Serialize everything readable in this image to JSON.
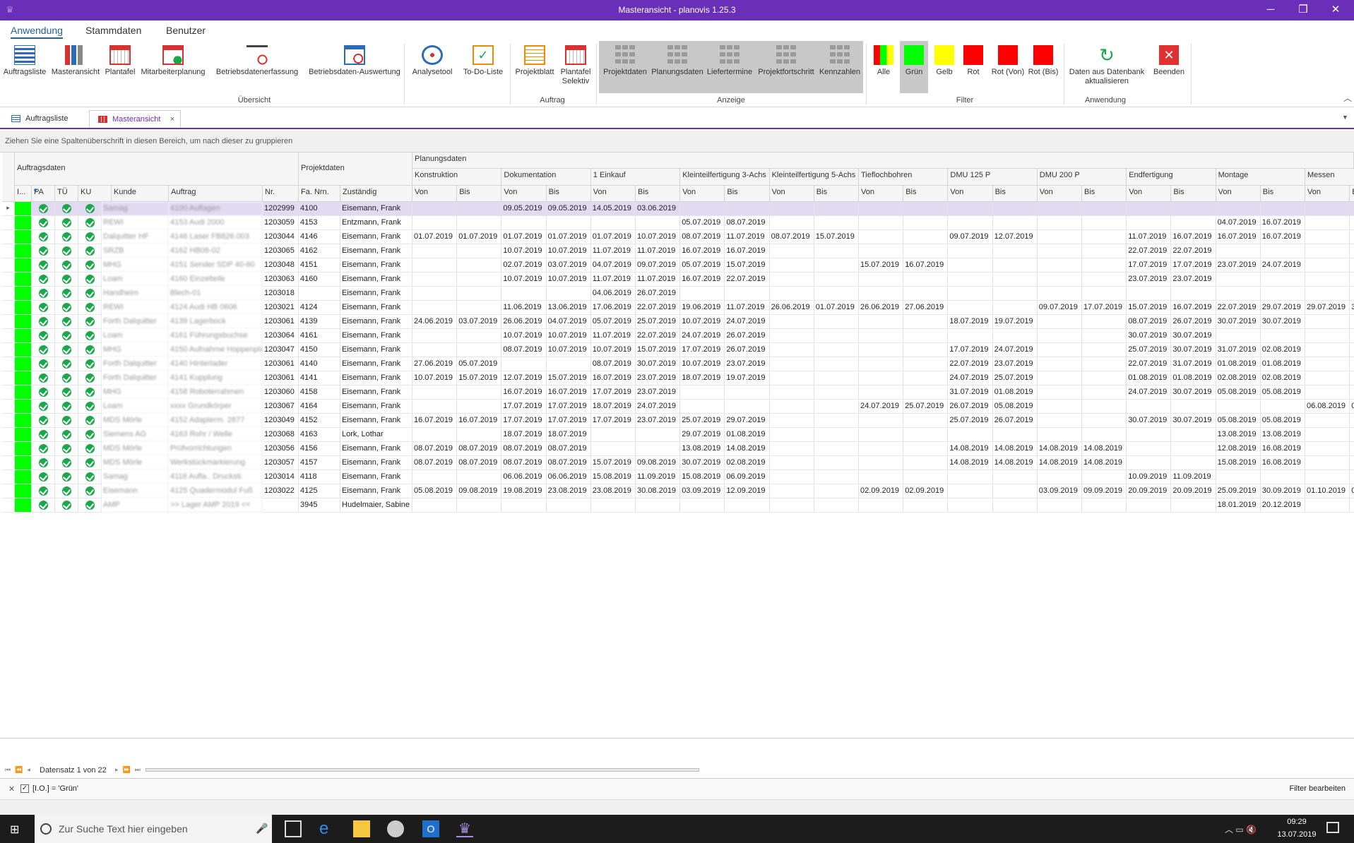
{
  "window": {
    "title": "Masteransicht - planovis 1.25.3"
  },
  "menu": [
    "Anwendung",
    "Stammdaten",
    "Benutzer"
  ],
  "ribbon": {
    "buttons": [
      "Auftragsliste",
      "Masteransicht",
      "Plantafel",
      "Mitarbeiterplanung",
      "Betriebsdatenerfassung",
      "Betriebsdaten-Auswertung",
      "Analysetool",
      "To-Do-Liste",
      "Projektblatt",
      "Plantafel Selektiv",
      "Projektdaten",
      "Planungsdaten",
      "Liefertermine",
      "Projektfortschritt",
      "Kennzahlen",
      "Alle",
      "Grün",
      "Gelb",
      "Rot",
      "Rot (Von)",
      "Rot (Bis)",
      "Daten aus Datenbank aktualisieren",
      "Beenden"
    ],
    "plantafel_selektiv": [
      "Plantafel",
      "Selektiv"
    ],
    "daten_aktualisieren": [
      "Daten aus Datenbank",
      "aktualisieren"
    ],
    "groups": [
      "Übersicht",
      "Auftrag",
      "Anzeige",
      "Filter",
      "Anwendung"
    ],
    "filter_colors": {
      "green": "#00ff00",
      "yellow": "#ffff00",
      "red": "#ff0000"
    }
  },
  "tabs": [
    "Auftragsliste",
    "Masteransicht"
  ],
  "groupbar": "Ziehen Sie eine Spaltenüberschrift in diesen Bereich, um nach dieser zu gruppieren",
  "bands": {
    "auftragsdaten": "Auftragsdaten",
    "projektdaten": "Projektdaten",
    "planungsdaten": "Planungsdaten"
  },
  "phases": [
    "Konstruktion",
    "Dokumentation",
    "1 Einkauf",
    "Kleinteilfertigung 3-Achs",
    "Kleinteilfertigung 5-Achs",
    "Tieflochbohren",
    "DMU 125 P",
    "DMU 200 P",
    "Endfertigung",
    "Montage",
    "Messen"
  ],
  "fixed_columns": [
    "I...",
    "PA",
    "TÜ",
    "KU",
    "Kunde",
    "Auftrag",
    "Nr.",
    "Fa. Nrn.",
    "Zuständig"
  ],
  "von": "Von",
  "bis": "Bis",
  "b_last": "B",
  "rows": [
    {
      "kunde": "Samag",
      "auftrag": "4100 Auflagen",
      "nr": "1202999",
      "fa": "4100",
      "zust": "Eisemann, Frank",
      "d": [
        "",
        "",
        "09.05.2019",
        "09.05.2019",
        "14.05.2019",
        "03.06.2019",
        "",
        "",
        "",
        "",
        "",
        "",
        "",
        "",
        "",
        "",
        "",
        "",
        "",
        "",
        "",
        ""
      ]
    },
    {
      "kunde": "REWI",
      "auftrag": "4153 Audi 2000",
      "nr": "1203059",
      "fa": "4153",
      "zust": "Entzmann, Frank",
      "d": [
        "",
        "",
        "",
        "",
        "",
        "",
        "05.07.2019",
        "08.07.2019",
        "",
        "",
        "",
        "",
        "",
        "",
        "",
        "",
        "",
        "",
        "04.07.2019",
        "16.07.2019",
        "",
        ""
      ]
    },
    {
      "kunde": "Dalquitter HF",
      "auftrag": "4146 Laser FB826.003",
      "nr": "1203044",
      "fa": "4146",
      "zust": "Eisemann, Frank",
      "d": [
        "01.07.2019",
        "01.07.2019",
        "01.07.2019",
        "01.07.2019",
        "01.07.2019",
        "10.07.2019",
        "08.07.2019",
        "11.07.2019",
        "08.07.2019",
        "15.07.2019",
        "",
        "",
        "09.07.2019",
        "12.07.2019",
        "",
        "",
        "11.07.2019",
        "16.07.2019",
        "16.07.2019",
        "16.07.2019",
        "",
        ""
      ]
    },
    {
      "kunde": "SRZB",
      "auftrag": "4162 HB08-02",
      "nr": "1203065",
      "fa": "4162",
      "zust": "Eisemann, Frank",
      "d": [
        "",
        "",
        "10.07.2019",
        "10.07.2019",
        "11.07.2019",
        "11.07.2019",
        "16.07.2019",
        "16.07.2019",
        "",
        "",
        "",
        "",
        "",
        "",
        "",
        "",
        "22.07.2019",
        "22.07.2019",
        "",
        "",
        "",
        ""
      ]
    },
    {
      "kunde": "MHG",
      "auftrag": "4151 Sender SDP 40-60",
      "nr": "1203048",
      "fa": "4151",
      "zust": "Eisemann, Frank",
      "d": [
        "",
        "",
        "02.07.2019",
        "03.07.2019",
        "04.07.2019",
        "09.07.2019",
        "05.07.2019",
        "15.07.2019",
        "",
        "",
        "15.07.2019",
        "16.07.2019",
        "",
        "",
        "",
        "",
        "17.07.2019",
        "17.07.2019",
        "23.07.2019",
        "24.07.2019",
        "",
        ""
      ]
    },
    {
      "kunde": "Loam",
      "auftrag": "4160 Einzelteile",
      "nr": "1203063",
      "fa": "4160",
      "zust": "Eisemann, Frank",
      "d": [
        "",
        "",
        "10.07.2019",
        "10.07.2019",
        "11.07.2019",
        "11.07.2019",
        "16.07.2019",
        "22.07.2019",
        "",
        "",
        "",
        "",
        "",
        "",
        "",
        "",
        "23.07.2019",
        "23.07.2019",
        "",
        "",
        "",
        ""
      ]
    },
    {
      "kunde": "Handheim",
      "auftrag": "Blech-01",
      "nr": "1203018",
      "fa": "",
      "zust": "Eisemann, Frank",
      "d": [
        "",
        "",
        "",
        "",
        "04.06.2019",
        "26.07.2019",
        "",
        "",
        "",
        "",
        "",
        "",
        "",
        "",
        "",
        "",
        "",
        "",
        "",
        "",
        "",
        ""
      ]
    },
    {
      "kunde": "REWI",
      "auftrag": "4124 Audi HB 0606",
      "nr": "1203021",
      "fa": "4124",
      "zust": "Eisemann, Frank",
      "d": [
        "",
        "",
        "11.06.2019",
        "13.06.2019",
        "17.06.2019",
        "22.07.2019",
        "19.06.2019",
        "11.07.2019",
        "26.06.2019",
        "01.07.2019",
        "26.06.2019",
        "27.06.2019",
        "",
        "",
        "09.07.2019",
        "17.07.2019",
        "15.07.2019",
        "16.07.2019",
        "22.07.2019",
        "29.07.2019",
        "29.07.2019",
        "3"
      ]
    },
    {
      "kunde": "Forth Dalquitter",
      "auftrag": "4139 Lagerbock",
      "nr": "1203061",
      "fa": "4139",
      "zust": "Eisemann, Frank",
      "d": [
        "24.06.2019",
        "03.07.2019",
        "26.06.2019",
        "04.07.2019",
        "05.07.2019",
        "25.07.2019",
        "10.07.2019",
        "24.07.2019",
        "",
        "",
        "",
        "",
        "18.07.2019",
        "19.07.2019",
        "",
        "",
        "08.07.2019",
        "26.07.2019",
        "30.07.2019",
        "30.07.2019",
        "",
        ""
      ]
    },
    {
      "kunde": "Loam",
      "auftrag": "4161 Führungsbuchse",
      "nr": "1203064",
      "fa": "4161",
      "zust": "Eisemann, Frank",
      "d": [
        "",
        "",
        "10.07.2019",
        "10.07.2019",
        "11.07.2019",
        "22.07.2019",
        "24.07.2019",
        "26.07.2019",
        "",
        "",
        "",
        "",
        "",
        "",
        "",
        "",
        "30.07.2019",
        "30.07.2019",
        "",
        "",
        "",
        ""
      ]
    },
    {
      "kunde": "MHG",
      "auftrag": "4150 Aufnahme Hoppenplatte",
      "nr": "1203047",
      "fa": "4150",
      "zust": "Eisemann, Frank",
      "d": [
        "",
        "",
        "08.07.2019",
        "10.07.2019",
        "10.07.2019",
        "15.07.2019",
        "17.07.2019",
        "26.07.2019",
        "",
        "",
        "",
        "",
        "17.07.2019",
        "24.07.2019",
        "",
        "",
        "25.07.2019",
        "30.07.2019",
        "31.07.2019",
        "02.08.2019",
        "",
        ""
      ]
    },
    {
      "kunde": "Forth Dalquitter",
      "auftrag": "4140 Hinterlader",
      "nr": "1203061",
      "fa": "4140",
      "zust": "Eisemann, Frank",
      "d": [
        "27.06.2019",
        "05.07.2019",
        "",
        "",
        "08.07.2019",
        "30.07.2019",
        "10.07.2019",
        "23.07.2019",
        "",
        "",
        "",
        "",
        "22.07.2019",
        "23.07.2019",
        "",
        "",
        "22.07.2019",
        "31.07.2019",
        "01.08.2019",
        "01.08.2019",
        "",
        ""
      ]
    },
    {
      "kunde": "Forth Dalquitter",
      "auftrag": "4141 Kupplung",
      "nr": "1203061",
      "fa": "4141",
      "zust": "Eisemann, Frank",
      "d": [
        "10.07.2019",
        "15.07.2019",
        "12.07.2019",
        "15.07.2019",
        "16.07.2019",
        "23.07.2019",
        "18.07.2019",
        "19.07.2019",
        "",
        "",
        "",
        "",
        "24.07.2019",
        "25.07.2019",
        "",
        "",
        "01.08.2019",
        "01.08.2019",
        "02.08.2019",
        "02.08.2019",
        "",
        ""
      ]
    },
    {
      "kunde": "MHG",
      "auftrag": "4158 Roboterrahmen",
      "nr": "1203060",
      "fa": "4158",
      "zust": "Eisemann, Frank",
      "d": [
        "",
        "",
        "16.07.2019",
        "16.07.2019",
        "17.07.2019",
        "23.07.2019",
        "",
        "",
        "",
        "",
        "",
        "",
        "31.07.2019",
        "01.08.2019",
        "",
        "",
        "24.07.2019",
        "30.07.2019",
        "05.08.2019",
        "05.08.2019",
        "",
        ""
      ]
    },
    {
      "kunde": "Loam",
      "auftrag": "xxxx Grundkörper",
      "nr": "1203067",
      "fa": "4164",
      "zust": "Eisemann, Frank",
      "d": [
        "",
        "",
        "17.07.2019",
        "17.07.2019",
        "18.07.2019",
        "24.07.2019",
        "",
        "",
        "",
        "",
        "24.07.2019",
        "25.07.2019",
        "26.07.2019",
        "05.08.2019",
        "",
        "",
        "",
        "",
        "",
        "",
        "06.08.2019",
        "0"
      ]
    },
    {
      "kunde": "MDS Mörle",
      "auftrag": "4152 Adapterm. 2877",
      "nr": "1203049",
      "fa": "4152",
      "zust": "Eisemann, Frank",
      "d": [
        "16.07.2019",
        "16.07.2019",
        "17.07.2019",
        "17.07.2019",
        "17.07.2019",
        "23.07.2019",
        "25.07.2019",
        "29.07.2019",
        "",
        "",
        "",
        "",
        "25.07.2019",
        "26.07.2019",
        "",
        "",
        "30.07.2019",
        "30.07.2019",
        "05.08.2019",
        "05.08.2019",
        "",
        ""
      ]
    },
    {
      "kunde": "Siemens AG",
      "auftrag": "4163 Rohr / Welle",
      "nr": "1203068",
      "fa": "4163",
      "zust": "Lork, Lothar",
      "d": [
        "",
        "",
        "18.07.2019",
        "18.07.2019",
        "",
        "",
        "29.07.2019",
        "01.08.2019",
        "",
        "",
        "",
        "",
        "",
        "",
        "",
        "",
        "",
        "",
        "13.08.2019",
        "13.08.2019",
        "",
        ""
      ]
    },
    {
      "kunde": "MDS Mörle",
      "auftrag": "Prüfvorrichtungen",
      "nr": "1203056",
      "fa": "4156",
      "zust": "Eisemann, Frank",
      "d": [
        "08.07.2019",
        "08.07.2019",
        "08.07.2019",
        "08.07.2019",
        "",
        "",
        "13.08.2019",
        "14.08.2019",
        "",
        "",
        "",
        "",
        "14.08.2019",
        "14.08.2019",
        "14.08.2019",
        "14.08.2019",
        "",
        "",
        "12.08.2019",
        "16.08.2019",
        "",
        ""
      ]
    },
    {
      "kunde": "MDS Mörle",
      "auftrag": "Werkstückmarkierung",
      "nr": "1203057",
      "fa": "4157",
      "zust": "Eisemann, Frank",
      "d": [
        "08.07.2019",
        "08.07.2019",
        "08.07.2019",
        "08.07.2019",
        "15.07.2019",
        "09.08.2019",
        "30.07.2019",
        "02.08.2019",
        "",
        "",
        "",
        "",
        "14.08.2019",
        "14.08.2019",
        "14.08.2019",
        "14.08.2019",
        "",
        "",
        "15.08.2019",
        "16.08.2019",
        "",
        ""
      ]
    },
    {
      "kunde": "Samag",
      "auftrag": "4118 Aufla.. Drucksti.",
      "nr": "1203014",
      "fa": "4118",
      "zust": "Eisemann, Frank",
      "d": [
        "",
        "",
        "06.06.2019",
        "06.06.2019",
        "15.08.2019",
        "11.09.2019",
        "15.08.2019",
        "06.09.2019",
        "",
        "",
        "",
        "",
        "",
        "",
        "",
        "",
        "10.09.2019",
        "11.09.2019",
        "",
        "",
        "",
        ""
      ]
    },
    {
      "kunde": "Eisemann",
      "auftrag": "4125 Quadermodul Fuß",
      "nr": "1203022",
      "fa": "4125",
      "zust": "Eisemann, Frank",
      "d": [
        "05.08.2019",
        "09.08.2019",
        "19.08.2019",
        "23.08.2019",
        "23.08.2019",
        "30.08.2019",
        "03.09.2019",
        "12.09.2019",
        "",
        "",
        "02.09.2019",
        "02.09.2019",
        "",
        "",
        "03.09.2019",
        "09.09.2019",
        "20.09.2019",
        "20.09.2019",
        "25.09.2019",
        "30.09.2019",
        "01.10.2019",
        "0"
      ]
    },
    {
      "kunde": "AMP",
      "auftrag": ">> Lager AMP 2019 <<",
      "nr": "",
      "fa": "3945",
      "zust": "Hudelmaier, Sabine",
      "d": [
        "",
        "",
        "",
        "",
        "",
        "",
        "",
        "",
        "",
        "",
        "",
        "",
        "",
        "",
        "",
        "",
        "",
        "",
        "18.01.2019",
        "20.12.2019",
        "",
        ""
      ]
    }
  ],
  "pager": {
    "text": "Datensatz 1 von 22"
  },
  "filter": {
    "expression": "[I.O.] = 'Grün'",
    "edit": "Filter bearbeiten"
  },
  "taskbar": {
    "search": "Zur Suche Text hier eingeben",
    "time": "09:29",
    "date": "13.07.2019"
  }
}
